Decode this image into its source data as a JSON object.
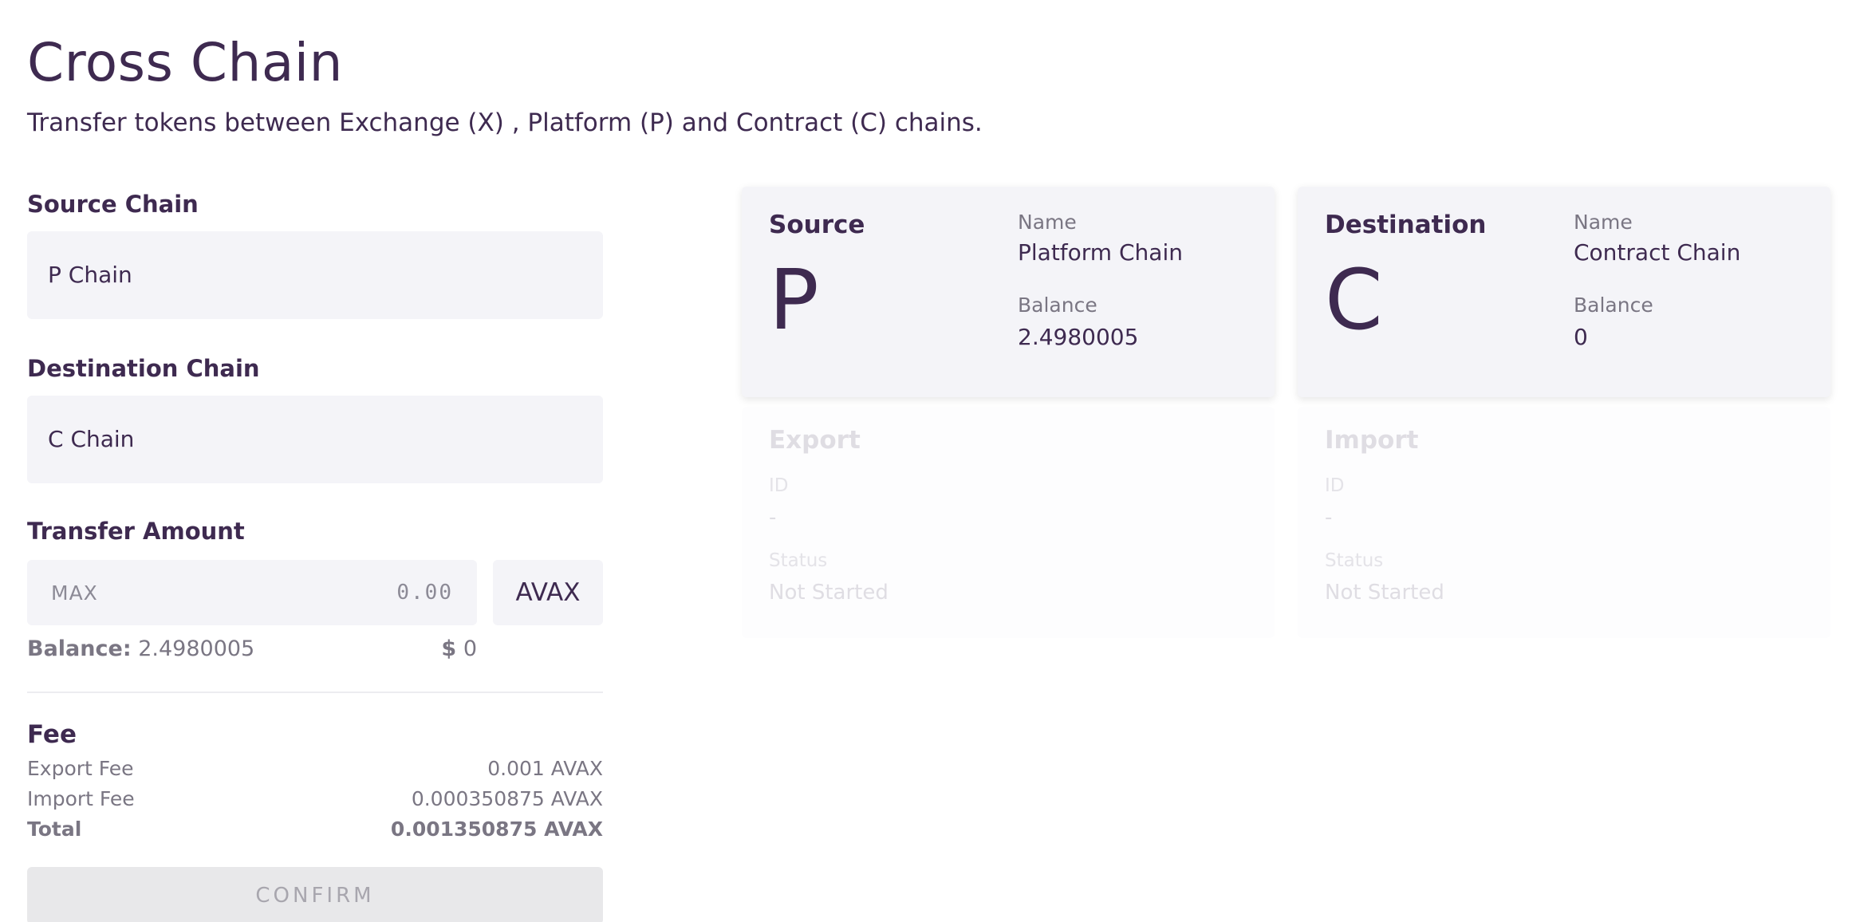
{
  "header": {
    "title": "Cross Chain",
    "subtitle": "Transfer tokens between Exchange (X) , Platform (P) and Contract (C) chains."
  },
  "form": {
    "source_label": "Source Chain",
    "source_value": "P Chain",
    "destination_label": "Destination Chain",
    "destination_value": "C Chain",
    "amount_label": "Transfer Amount",
    "max_label": "MAX",
    "amount_placeholder": "0.00",
    "currency": "AVAX",
    "balance_label": "Balance:",
    "balance_value": "2.4980005",
    "usd_symbol": "$",
    "usd_value": "0"
  },
  "fee": {
    "title": "Fee",
    "rows": [
      {
        "label": "Export Fee",
        "value": "0.001 AVAX"
      },
      {
        "label": "Import Fee",
        "value": "0.000350875 AVAX"
      },
      {
        "label": "Total",
        "value": "0.001350875 AVAX"
      }
    ]
  },
  "confirm_label": "CONFIRM",
  "source_card": {
    "title": "Source",
    "letter": "P",
    "name_label": "Name",
    "name_value": "Platform Chain",
    "balance_label": "Balance",
    "balance_value": "2.4980005"
  },
  "destination_card": {
    "title": "Destination",
    "letter": "C",
    "name_label": "Name",
    "name_value": "Contract Chain",
    "balance_label": "Balance",
    "balance_value": "0"
  },
  "export_status": {
    "title": "Export",
    "id_label": "ID",
    "id_value": "-",
    "status_label": "Status",
    "status_value": "Not Started"
  },
  "import_status": {
    "title": "Import",
    "id_label": "ID",
    "id_value": "-",
    "status_label": "Status",
    "status_value": "Not Started"
  }
}
